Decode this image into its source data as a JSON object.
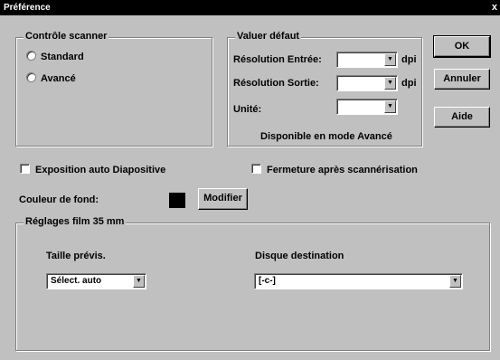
{
  "window": {
    "title": "Préférence",
    "close_glyph": "x"
  },
  "scanner_group": {
    "title": "Contrôle scanner",
    "options": [
      {
        "label": "Standard"
      },
      {
        "label": "Avancé"
      }
    ]
  },
  "defaults_group": {
    "title": "Valuer défaut",
    "input_resolution_label": "Résolution Entrée:",
    "input_resolution_unit": "dpi",
    "output_resolution_label": "Résolution Sortie:",
    "output_resolution_unit": "dpi",
    "unit_label": "Unité:",
    "note": "Disponible en mode Avancé"
  },
  "buttons": {
    "ok": "OK",
    "cancel": "Annuler",
    "help": "Aide",
    "modify": "Modifier"
  },
  "options": {
    "auto_exposure": "Exposition auto Diapositive",
    "close_after_scan": "Fermeture après scannérisation"
  },
  "background_color": {
    "label": "Couleur de fond:",
    "value": "#000000"
  },
  "film_group": {
    "title": "Réglages film 35 mm",
    "preview_size_label": "Taille prévis.",
    "preview_size_value": "Sélect. auto",
    "destination_label": "Disque destination",
    "destination_value": "[-c-]"
  }
}
